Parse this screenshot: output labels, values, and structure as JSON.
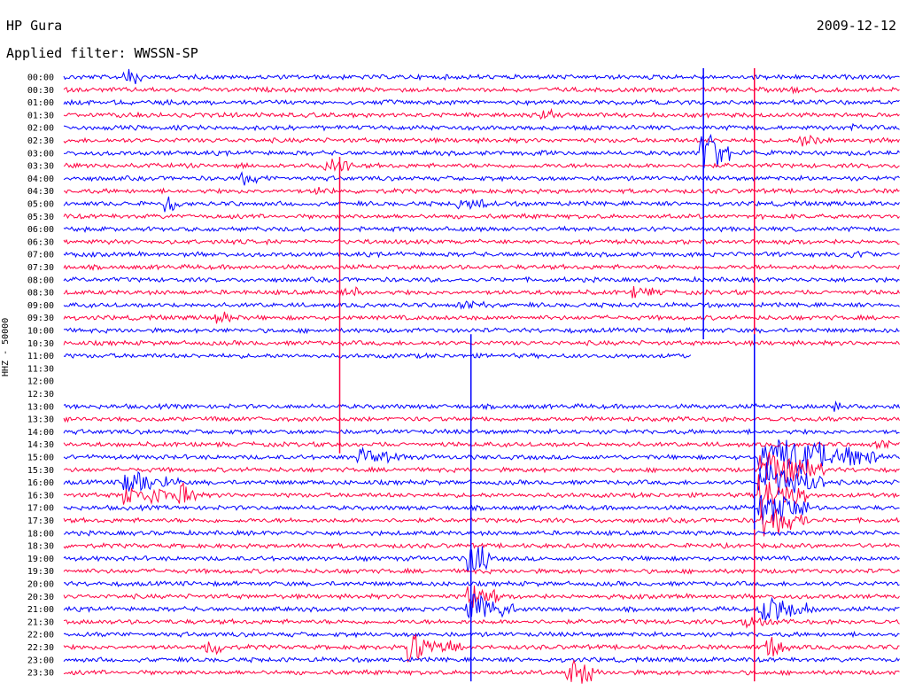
{
  "header": {
    "station": "HP Gura",
    "date": "2009-12-12",
    "filter_label": "Applied filter: WWSSN-SP",
    "channel_label": "HHZ - 50000"
  },
  "colors": {
    "line_a": "#0000ff",
    "line_b": "#ff0040",
    "background": "#ffffff"
  },
  "chart_data": {
    "type": "line",
    "title": "HP Gura",
    "ylabel": "HHZ - 50000",
    "grid": false,
    "legend": "none",
    "categories": [
      "00:00",
      "00:30",
      "01:00",
      "01:30",
      "02:00",
      "02:30",
      "03:00",
      "03:30",
      "04:00",
      "04:30",
      "05:00",
      "05:30",
      "06:00",
      "06:30",
      "07:00",
      "07:30",
      "08:00",
      "08:30",
      "09:00",
      "09:30",
      "10:00",
      "10:30",
      "11:00",
      "11:30",
      "12:00",
      "12:30",
      "13:00",
      "13:30",
      "14:00",
      "14:30",
      "15:00",
      "15:30",
      "16:00",
      "16:30",
      "17:00",
      "17:30",
      "18:00",
      "18:30",
      "19:00",
      "19:30",
      "20:00",
      "20:30",
      "21:00",
      "21:30",
      "22:00",
      "22:30",
      "23:00",
      "23:30"
    ],
    "trace_extent": [
      1,
      1,
      1,
      1,
      1,
      1,
      1,
      1,
      1,
      1,
      1,
      1,
      1,
      1,
      1,
      1,
      1,
      1,
      1,
      1,
      1,
      1,
      0.75,
      0,
      0,
      0.92,
      1,
      1,
      1,
      1,
      1,
      1,
      1,
      1,
      1,
      1,
      1,
      1,
      1,
      1,
      1,
      1,
      1,
      1,
      1,
      1,
      1,
      1
    ],
    "trace_start": [
      0,
      0,
      0,
      0,
      0,
      0,
      0,
      0,
      0,
      0,
      0,
      0,
      0,
      0,
      0,
      0,
      0,
      0,
      0,
      0,
      0,
      0,
      0,
      0,
      0,
      0.92,
      0,
      0,
      0,
      0,
      0,
      0,
      0,
      0,
      0,
      0,
      0,
      0,
      0,
      0,
      0,
      0,
      0,
      0,
      0,
      0,
      0,
      0
    ],
    "events": [
      {
        "row": 0,
        "x": 0.07,
        "amp": 14,
        "len": 0.03
      },
      {
        "row": 1,
        "x": 0.87,
        "amp": 6,
        "len": 0.02
      },
      {
        "row": 3,
        "x": 0.57,
        "amp": 12,
        "len": 0.02
      },
      {
        "row": 4,
        "x": 0.08,
        "amp": 5,
        "len": 0.03
      },
      {
        "row": 4,
        "x": 0.94,
        "amp": 6,
        "len": 0.03
      },
      {
        "row": 5,
        "x": 0.88,
        "amp": 9,
        "len": 0.04
      },
      {
        "row": 6,
        "x": 0.57,
        "amp": 6,
        "len": 0.02
      },
      {
        "row": 6,
        "x": 0.76,
        "amp": 35,
        "len": 0.04
      },
      {
        "row": 7,
        "x": 0.31,
        "amp": 12,
        "len": 0.05
      },
      {
        "row": 8,
        "x": 0.21,
        "amp": 10,
        "len": 0.04
      },
      {
        "row": 9,
        "x": 0.3,
        "amp": 8,
        "len": 0.03
      },
      {
        "row": 10,
        "x": 0.12,
        "amp": 14,
        "len": 0.02
      },
      {
        "row": 10,
        "x": 0.47,
        "amp": 10,
        "len": 0.05
      },
      {
        "row": 14,
        "x": 0.94,
        "amp": 8,
        "len": 0.03
      },
      {
        "row": 17,
        "x": 0.33,
        "amp": 12,
        "len": 0.03
      },
      {
        "row": 17,
        "x": 0.68,
        "amp": 10,
        "len": 0.04
      },
      {
        "row": 18,
        "x": 0.47,
        "amp": 8,
        "len": 0.05
      },
      {
        "row": 19,
        "x": 0.18,
        "amp": 12,
        "len": 0.03
      },
      {
        "row": 25,
        "x": 0.93,
        "amp": 10,
        "len": 0.06
      },
      {
        "row": 26,
        "x": 0.14,
        "amp": 6,
        "len": 0.02
      },
      {
        "row": 26,
        "x": 0.92,
        "amp": 8,
        "len": 0.02
      },
      {
        "row": 29,
        "x": 0.97,
        "amp": 9,
        "len": 0.03
      },
      {
        "row": 30,
        "x": 0.35,
        "amp": 12,
        "len": 0.06
      },
      {
        "row": 30,
        "x": 0.83,
        "amp": 30,
        "len": 0.15
      },
      {
        "row": 31,
        "x": 0.83,
        "amp": 30,
        "len": 0.08
      },
      {
        "row": 32,
        "x": 0.07,
        "amp": 18,
        "len": 0.07
      },
      {
        "row": 32,
        "x": 0.83,
        "amp": 30,
        "len": 0.08
      },
      {
        "row": 33,
        "x": 0.07,
        "amp": 18,
        "len": 0.06
      },
      {
        "row": 33,
        "x": 0.13,
        "amp": 22,
        "len": 0.03
      },
      {
        "row": 33,
        "x": 0.83,
        "amp": 30,
        "len": 0.06
      },
      {
        "row": 34,
        "x": 0.83,
        "amp": 28,
        "len": 0.06
      },
      {
        "row": 35,
        "x": 0.83,
        "amp": 25,
        "len": 0.06
      },
      {
        "row": 38,
        "x": 0.48,
        "amp": 30,
        "len": 0.03
      },
      {
        "row": 41,
        "x": 0.48,
        "amp": 25,
        "len": 0.04
      },
      {
        "row": 42,
        "x": 0.48,
        "amp": 22,
        "len": 0.06
      },
      {
        "row": 42,
        "x": 0.83,
        "amp": 20,
        "len": 0.07
      },
      {
        "row": 43,
        "x": 0.81,
        "amp": 10,
        "len": 0.04
      },
      {
        "row": 45,
        "x": 0.17,
        "amp": 12,
        "len": 0.03
      },
      {
        "row": 45,
        "x": 0.41,
        "amp": 22,
        "len": 0.07
      },
      {
        "row": 45,
        "x": 0.84,
        "amp": 18,
        "len": 0.03
      },
      {
        "row": 47,
        "x": 0.6,
        "amp": 22,
        "len": 0.04
      }
    ],
    "spikes": [
      {
        "row_from": 0,
        "row_to": 20,
        "x": 0.765,
        "color": "line_a"
      },
      {
        "row_from": 7,
        "row_to": 29,
        "x": 0.33,
        "color": "line_b"
      },
      {
        "row_from": 21,
        "row_to": 47,
        "x": 0.487,
        "color": "line_a"
      },
      {
        "row_from": 0,
        "row_to": 47,
        "x": 0.826,
        "color": "line_b"
      },
      {
        "row_from": 21,
        "row_to": 35,
        "x": 0.826,
        "color": "line_a"
      }
    ]
  }
}
